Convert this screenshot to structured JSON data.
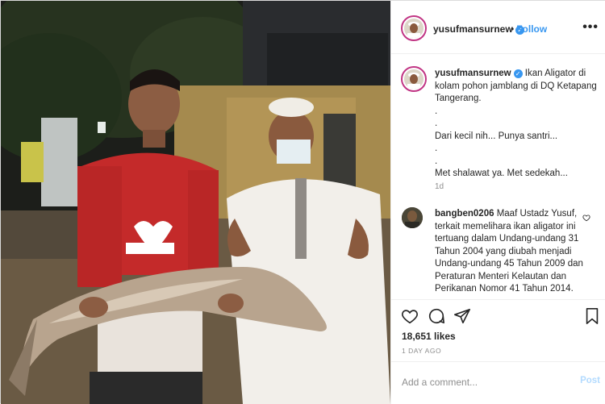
{
  "post": {
    "username": "yusufmansurnew",
    "follow_label": "Follow",
    "follow_separator": "•",
    "more_label": "•••"
  },
  "caption": {
    "username": "yusufmansurnew",
    "text_line1": " Ikan Aligator di kolam pohon jamblang di DQ Ketapang Tangerang.",
    "dot1": ".",
    "dot2": ".",
    "line2": "Dari kecil nih... Punya santri...",
    "dot3": ".",
    "dot4": ".",
    "line3": "Met shalawat ya. Met sedekah...",
    "age": "1d"
  },
  "comment": {
    "username": "bangben0206",
    "text": " Maaf Ustadz Yusuf, terkait memelihara ikan aligator ini tertuang dalam Undang-undang 31 Tahun 2004 yang diubah menjadi Undang-undang 45 Tahun 2009 dan Peraturan Menteri Kelautan dan Perikanan Nomor 41 Tahun 2014."
  },
  "actions": {
    "likes": "18,651 likes",
    "timestamp": "1 DAY AGO"
  },
  "add_comment": {
    "placeholder": "Add a comment...",
    "post_label": "Post"
  },
  "colors": {
    "link_blue": "#3897f0",
    "post_disabled": "#b3dbff",
    "ring": "#c13584"
  }
}
